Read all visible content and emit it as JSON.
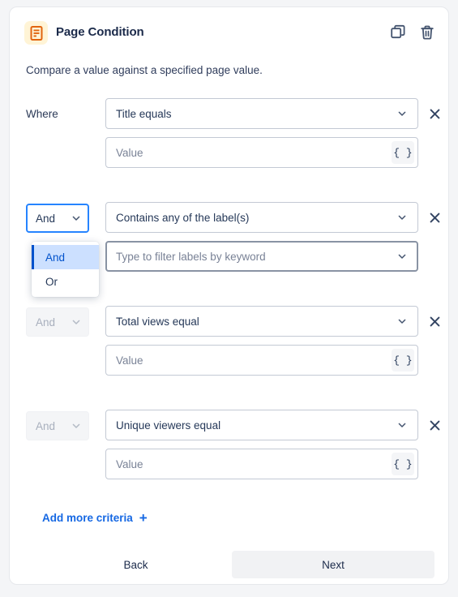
{
  "header": {
    "icon": "page-document-icon",
    "title": "Page Condition",
    "duplicate_icon": "copy-icon",
    "delete_icon": "trash-icon"
  },
  "description": "Compare a value against a specified page value.",
  "rows": [
    {
      "label": "Where",
      "condition": "Title equals",
      "value_placeholder": "Value",
      "brace_label": "{ }",
      "remove_label": "✕"
    },
    {
      "conjunction": "And",
      "condition": "Contains any of the label(s)",
      "value_placeholder": "Type to filter labels by keyword",
      "remove_label": "✕"
    },
    {
      "conjunction": "And",
      "condition": "Total views equal",
      "value_placeholder": "Value",
      "brace_label": "{ }",
      "remove_label": "✕"
    },
    {
      "conjunction": "And",
      "condition": "Unique viewers equal",
      "value_placeholder": "Value",
      "brace_label": "{ }",
      "remove_label": "✕"
    }
  ],
  "dropdown": {
    "open": true,
    "options": [
      "And",
      "Or"
    ],
    "selected": "And"
  },
  "footer": {
    "add_more_label": "Add more criteria",
    "add_more_icon": "plus-icon",
    "back_label": "Back",
    "next_label": "Next"
  },
  "colors": {
    "accent_blue": "#1668e3",
    "selected_blue": "#0052cc",
    "selected_bg": "#cce0ff",
    "focus_blue": "#2684ff",
    "icon_orange": "#e2650f",
    "icon_bg": "#fff4d6",
    "text_dark": "#253858",
    "placeholder": "#798296",
    "border": "#c3c9d4",
    "disabled_bg": "#f4f5f7",
    "page_bg": "#f4f5f7"
  }
}
